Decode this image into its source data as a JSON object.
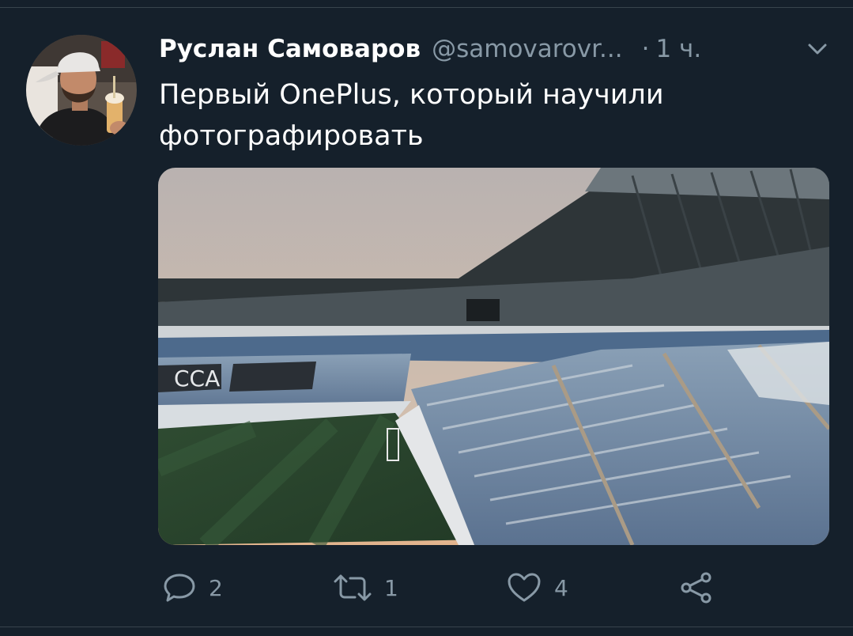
{
  "tweet": {
    "author_name": "Руслан Самоваров",
    "author_handle": "@samovarovr...",
    "separator": "·",
    "timestamp": "1 ч.",
    "text_lines": [
      "Первый OnePlus, который научили",
      "фотографировать"
    ],
    "media": {
      "alt": "stadium-photo",
      "stand_lettering": "CCA"
    }
  },
  "actions": {
    "reply_count": "2",
    "retweet_count": "1",
    "like_count": "4"
  },
  "colors": {
    "background": "#15202b",
    "primary_text": "#ffffff",
    "secondary_text": "#8899a6",
    "divider": "#38444d"
  },
  "icons": [
    "chevron-down-icon",
    "reply-icon",
    "retweet-icon",
    "like-icon",
    "share-icon"
  ]
}
